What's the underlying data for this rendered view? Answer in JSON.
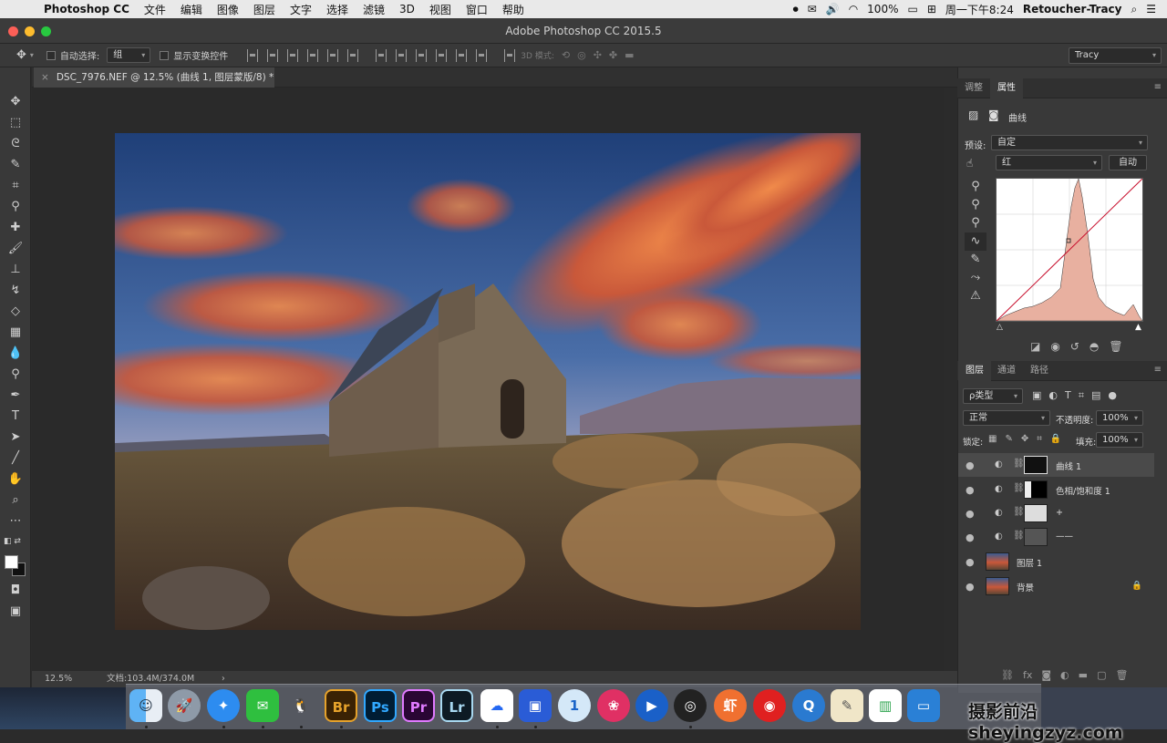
{
  "menubar": {
    "app_name": "Photoshop CC",
    "items": [
      "文件",
      "编辑",
      "图像",
      "图层",
      "文字",
      "选择",
      "滤镜",
      "3D",
      "视图",
      "窗口",
      "帮助"
    ],
    "battery": "100%",
    "clock": "周一下午8:24",
    "user": "Retoucher-Tracy"
  },
  "window": {
    "title": "Adobe Photoshop CC 2015.5"
  },
  "options": {
    "auto_select_label": "自动选择:",
    "auto_select_value": "组",
    "show_transform_label": "显示变换控件",
    "mode_3d_label": "3D 模式:",
    "workspace": "Tracy"
  },
  "document": {
    "tab_title": "DSC_7976.NEF @ 12.5% (曲线 1, 图层蒙版/8) *",
    "zoom": "12.5%",
    "doc_info": "文档:103.4M/374.0M"
  },
  "properties_panel": {
    "tabs": [
      "调整",
      "属性"
    ],
    "active_tab": "属性",
    "adjustment_name": "曲线",
    "preset_label": "预设:",
    "preset_value": "自定",
    "channel_value": "红",
    "auto_button": "自动"
  },
  "layers_panel": {
    "tabs": [
      "图层",
      "通道",
      "路径"
    ],
    "active_tab": "图层",
    "filter_kind": "ρ类型",
    "blend_mode": "正常",
    "opacity_label": "不透明度:",
    "opacity_value": "100%",
    "lock_label": "锁定:",
    "fill_label": "填充:",
    "fill_value": "100%",
    "layers": [
      {
        "name": "曲线 1",
        "selected": true
      },
      {
        "name": "色相/饱和度 1",
        "selected": false
      },
      {
        "name": "+",
        "selected": false
      },
      {
        "name": "——",
        "selected": false
      },
      {
        "name": "图层 1",
        "selected": false
      },
      {
        "name": "背景",
        "selected": false
      }
    ]
  },
  "dock": {
    "apps": [
      "Finder",
      "Launchpad",
      "Safari",
      "WeChat",
      "QQ",
      "Br",
      "Ps",
      "Pr",
      "Lr",
      "Baidu",
      "Tools",
      "1Password",
      "DaVinci",
      "Video",
      "OBS",
      "Xiami",
      "NetEase Music",
      "QuickTime",
      "Preview",
      "Numbers",
      "Keynote"
    ]
  },
  "watermark": "摄影前沿 sheyingzyz.com"
}
